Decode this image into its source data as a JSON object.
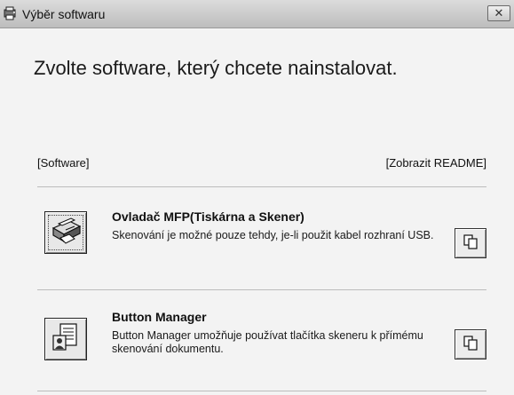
{
  "window": {
    "title": "Výběr softwaru",
    "close_label": "✕"
  },
  "heading": "Zvolte software, který chcete nainstalovat.",
  "section": {
    "left_label": "[Software]",
    "right_label": "[Zobrazit README]"
  },
  "items": [
    {
      "title": "Ovladač MFP(Tiskárna a Skener)",
      "description": "Skenování je možné pouze tehdy, je-li použit kabel rozhraní USB.",
      "icon": "printer-scanner-icon",
      "readme_icon": "document-copy-icon"
    },
    {
      "title": "Button Manager",
      "description": "Button Manager umožňuje používat tlačítka skeneru k přímému skenování dokumentu.",
      "icon": "button-manager-icon",
      "readme_icon": "document-copy-icon"
    }
  ]
}
